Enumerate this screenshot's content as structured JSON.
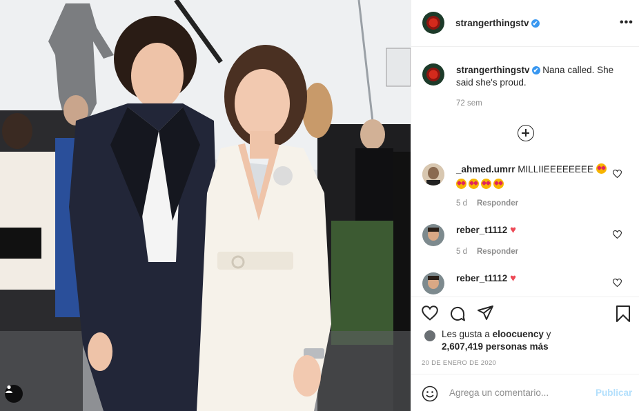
{
  "header": {
    "username": "strangerthingstv",
    "verified_badge": "✔",
    "more_label": "•••"
  },
  "caption": {
    "username": "strangerthingstv",
    "text": "Nana called. She said she's proud.",
    "time": "72 sem"
  },
  "load_more_icon": "plus-circle-icon",
  "comments": [
    {
      "username": "_ahmed.umrr",
      "text": "MILLIIEEEEEEEE",
      "emoji_count": 5,
      "time": "5 d",
      "reply_label": "Responder"
    },
    {
      "username": "reber_t1112",
      "text": "♥",
      "time": "5 d",
      "reply_label": "Responder"
    },
    {
      "username": "reber_t1112",
      "text": "♥"
    }
  ],
  "likes": {
    "prefix": "Les gusta a",
    "liker": "eloocuency",
    "connector": "y",
    "count_text": "2,607,419 personas más"
  },
  "date": "20 DE ENERO DE 2020",
  "add_comment": {
    "placeholder": "Agrega un comentario...",
    "publish_label": "Publicar"
  },
  "colors": {
    "accent": "#3897f0",
    "publish_disabled": "#b2dffc",
    "heart": "#ed4956"
  }
}
